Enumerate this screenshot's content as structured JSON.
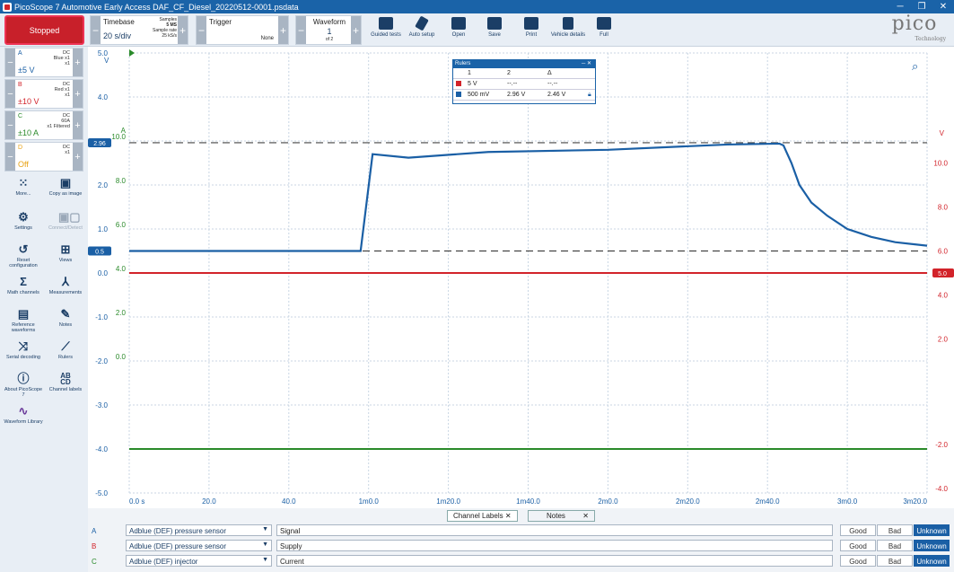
{
  "window": {
    "title": "PicoScope 7 Automotive Early Access DAF_CF_Diesel_20220512-0001.psdata"
  },
  "toolbar": {
    "stop_label": "Stopped",
    "timebase_label": "Timebase",
    "timebase_value": "20 s/div",
    "samples_label": "Samples",
    "samples_value": "5 MS",
    "sample_rate_label": "Sample rate",
    "sample_rate_value": "25 kS/s",
    "trigger_label": "Trigger",
    "trigger_value": "None",
    "waveform_label": "Waveform",
    "waveform_value": "1",
    "waveform_of": "of 2",
    "tools": [
      "Guided tests",
      "Auto setup",
      "Open",
      "Save",
      "Print",
      "Vehicle details",
      "Full"
    ],
    "logo_text": "pico",
    "logo_sub": "Technology"
  },
  "channels": [
    {
      "letter": "A",
      "range": "±5 V",
      "coupling": "DC",
      "probe": "Blue x1",
      "extra": "x1",
      "color": "#1a5fa5"
    },
    {
      "letter": "B",
      "range": "±10 V",
      "coupling": "DC",
      "probe": "Red x1",
      "extra": "x1",
      "color": "#d2232a"
    },
    {
      "letter": "C",
      "range": "±10 A",
      "coupling": "DC",
      "probe": "60A",
      "extra": "x1 Filtered",
      "color": "#2a8a2a"
    },
    {
      "letter": "D",
      "range": "Off",
      "coupling": "DC",
      "probe": "x1",
      "extra": "",
      "color": "#e8a317"
    }
  ],
  "sidebar": {
    "more": "More...",
    "copy": "Copy as image",
    "settings": "Settings",
    "connect": "Connect/Detect",
    "reset": "Reset configuration",
    "views": "Views",
    "math": "Math channels",
    "measurements": "Measurements",
    "reference": "Reference waveforms",
    "notes": "Notes",
    "serial": "Serial decoding",
    "rulers": "Rulers",
    "about": "About PicoScope 7",
    "channel_labels": "Channel labels",
    "library": "Waveform Library"
  },
  "plot": {
    "axis_a_unit": "V",
    "axis_b_unit": "V",
    "axis_a_ticks": [
      "5.0",
      "4.0",
      "3.0",
      "2.0",
      "1.0",
      "0.0",
      "-1.0",
      "-2.0",
      "-3.0",
      "-4.0",
      "-5.0"
    ],
    "axis_c_label": "A",
    "axis_c_ticks": [
      "10.0",
      "8.0",
      "6.0",
      "4.0",
      "2.0",
      "0.0"
    ],
    "axis_b_ticks": [
      "10.0",
      "8.0",
      "6.0",
      "4.0",
      "2.0",
      "-2.0",
      "-4.0"
    ],
    "x_ticks": [
      "0.0 s",
      "20.0",
      "40.0",
      "1m0.0",
      "1m20.0",
      "1m40.0",
      "2m0.0",
      "2m20.0",
      "2m40.0",
      "3m0.0",
      "3m20.0"
    ],
    "ruler_high": "2.96",
    "ruler_low": "0.5",
    "ruler_b": "5.0"
  },
  "rulers_panel": {
    "title": "Rulers",
    "col1": "1",
    "col2": "2",
    "col3": "Δ",
    "row1": [
      "5 V",
      "--.--",
      "--.--"
    ],
    "row2": [
      "500 mV",
      "2.96 V",
      "2.46 V"
    ]
  },
  "tabs": {
    "channel_labels": "Channel Labels",
    "notes": "Notes"
  },
  "channel_rows": [
    {
      "letter": "A",
      "sensor": "Adblue (DEF) pressure sensor",
      "note": "Signal",
      "good": "Good",
      "bad": "Bad",
      "unknown": "Unknown"
    },
    {
      "letter": "B",
      "sensor": "Adblue (DEF) pressure sensor",
      "note": "Supply",
      "good": "Good",
      "bad": "Bad",
      "unknown": "Unknown"
    },
    {
      "letter": "C",
      "sensor": "Adblue (DEF) injector",
      "note": "Current",
      "good": "Good",
      "bad": "Bad",
      "unknown": "Unknown"
    }
  ]
}
